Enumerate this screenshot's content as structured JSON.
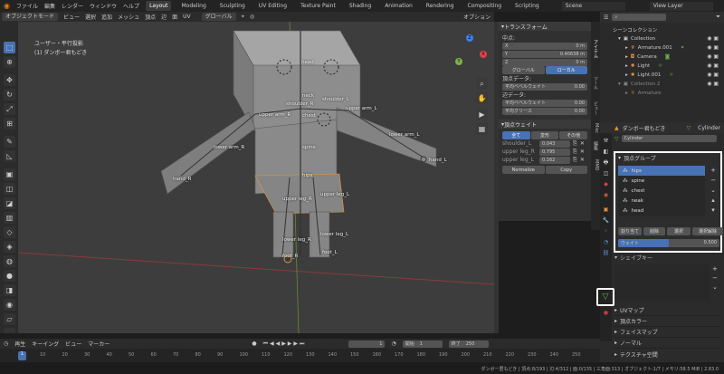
{
  "menu": {
    "file": "ファイル",
    "edit": "編集",
    "render": "レンダー",
    "window": "ウィンドウ",
    "help": "ヘルプ"
  },
  "workspaces": [
    "Layout",
    "Modeling",
    "Sculpting",
    "UV Editing",
    "Texture Paint",
    "Shading",
    "Animation",
    "Rendering",
    "Compositing",
    "Scripting"
  ],
  "scene": "Scene",
  "viewlayer": "View Layer",
  "viewport": {
    "mode": "オブジェクトモード",
    "view": "ビュー",
    "select": "選択",
    "add": "追加",
    "mesh": "メッシュ",
    "vertex": "頂点",
    "edge": "辺",
    "face": "面",
    "uv": "UV",
    "transform": "グローバル",
    "options": "オプション",
    "info1": "ユーザー・平行投影",
    "info2": "(1) ダンボー君もどき"
  },
  "bones": [
    {
      "name": "head"
    },
    {
      "name": "neck"
    },
    {
      "name": "shoulder_R"
    },
    {
      "name": "shoulder_L"
    },
    {
      "name": "upper arm_R"
    },
    {
      "name": "upper arm_L"
    },
    {
      "name": "chest"
    },
    {
      "name": "lower arm_R"
    },
    {
      "name": "lower arm_L"
    },
    {
      "name": "spine"
    },
    {
      "name": "hand_R"
    },
    {
      "name": "hand_L"
    },
    {
      "name": "hips"
    },
    {
      "name": "upper leg_R"
    },
    {
      "name": "upper leg_L"
    },
    {
      "name": "lower leg_R"
    },
    {
      "name": "lower leg_L"
    },
    {
      "name": "foot_R"
    },
    {
      "name": "foot_L"
    }
  ],
  "npanel": {
    "transform": "トランスフォーム",
    "median": "中点:",
    "x_label": "X",
    "x": "0 m",
    "y_label": "Y",
    "y": "0.40638 m",
    "z_label": "Z",
    "z": "0 m",
    "global": "グローバル",
    "local": "ローカル",
    "vertexdata": "頂点データ:",
    "avgbevel": "平均ベベルウェイト",
    "avgbevel_val": "0.00",
    "edgedata": "辺データ:",
    "avgbevel2": "平均ベベルウェイト",
    "avgbevel2_val": "0.00",
    "avgcrease": "平均クリース",
    "avgcrease_val": "0.00",
    "vweights": "頂点ウェイト",
    "all": "全て",
    "deform": "変形",
    "other": "その他",
    "weights": [
      {
        "name": "shoulder_L",
        "val": "0.043"
      },
      {
        "name": "upper leg_R",
        "val": "0.795"
      },
      {
        "name": "upper leg_L",
        "val": "0.162"
      }
    ],
    "normalize": "Normalize",
    "copy": "Copy"
  },
  "ntabs": [
    "アイテム",
    "ツール",
    "ビュー",
    "Misc",
    "編集",
    "MMD"
  ],
  "outliner": {
    "scene_collection": "シーンコレクション",
    "items": [
      {
        "name": "Collection"
      },
      {
        "name": "Armature.001"
      },
      {
        "name": "Camera"
      },
      {
        "name": "Light"
      },
      {
        "name": "Light.001"
      },
      {
        "name": "Collection 2"
      },
      {
        "name": "Armature"
      }
    ]
  },
  "props": {
    "object": "ダンボー君もどき",
    "data": "Cylinder",
    "datafield": "Cylinder",
    "vgroups_header": "頂点グループ",
    "vgroups": [
      "hips",
      "spine",
      "chest",
      "neak",
      "head"
    ],
    "assign": "割り当て",
    "remove": "削除",
    "select": "選択",
    "deselect": "選択解除",
    "weight_label": "ウェイト",
    "weight": "0.500",
    "weight_fraction": 0.5,
    "shapekeys": "シェイプキー",
    "sections": [
      "UVマップ",
      "頂点カラー",
      "フェイスマップ",
      "ノーマル",
      "テクスチャ空間"
    ]
  },
  "timeline": {
    "playback": "再生",
    "keying": "キーイング",
    "view": "ビュー",
    "marker": "マーカー",
    "frame": "1",
    "start_label": "開始",
    "start": "1",
    "end_label": "終了",
    "end": "250",
    "ticks": [
      "10",
      "20",
      "30",
      "40",
      "50",
      "60",
      "70",
      "80",
      "90",
      "100",
      "110",
      "120",
      "130",
      "140",
      "150",
      "160",
      "170",
      "180",
      "190",
      "200",
      "210",
      "220",
      "230",
      "240",
      "250"
    ],
    "current_tick": "1"
  },
  "status": "ダンボー君もどき | 頂点:8/193 | 辺:4/312 | 面:0/135 | 三角面:313 | オブジェクト:1/7 | メモリ:58.5 MiB | 2.83.0",
  "colors": {
    "accent": "#4772b3",
    "selected_outline": "#ffa033"
  }
}
